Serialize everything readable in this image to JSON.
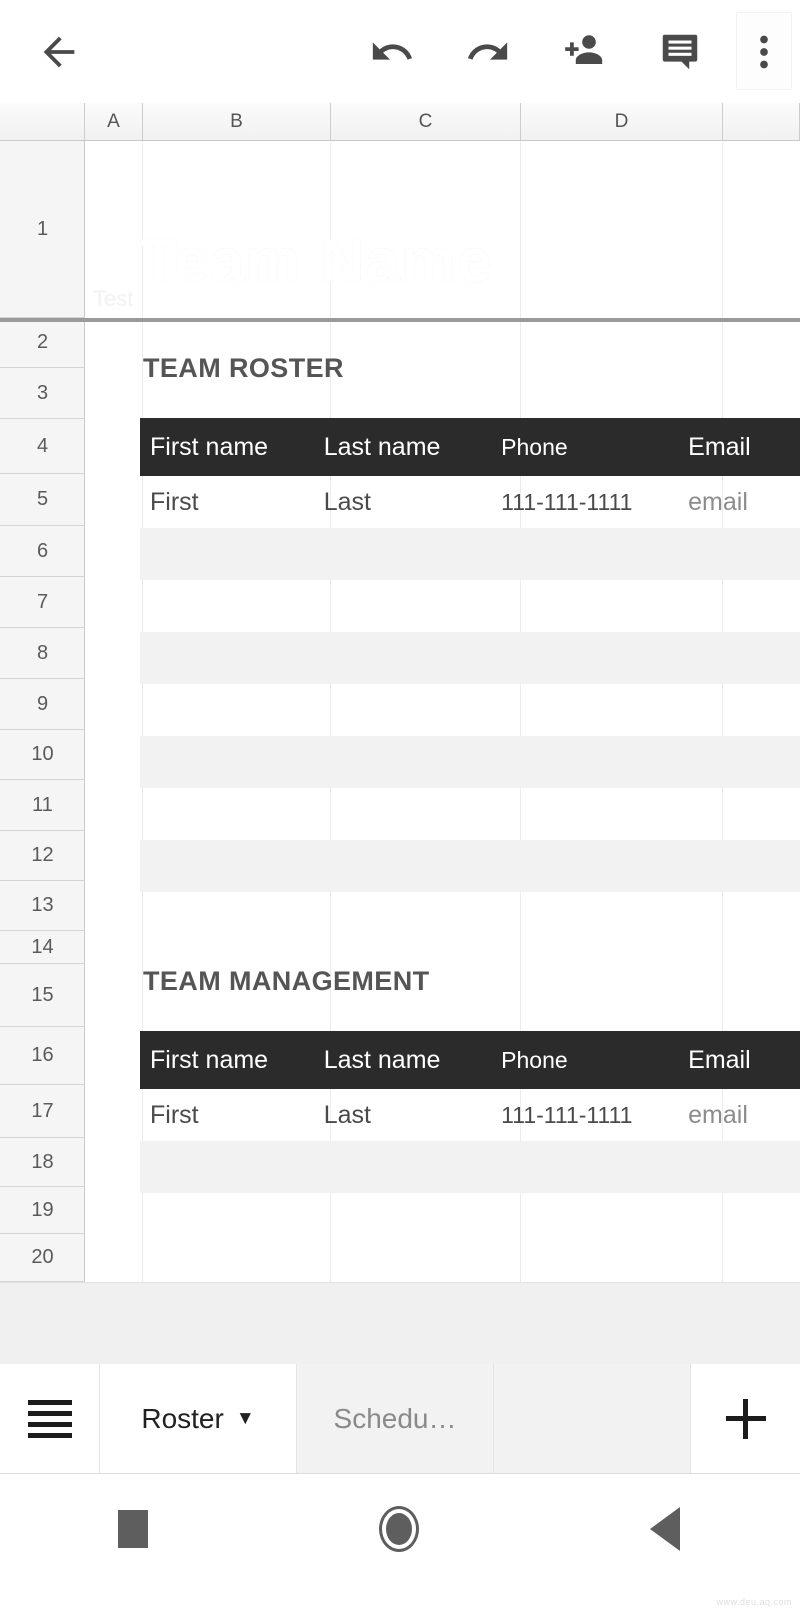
{
  "toolbar": {
    "back_label": "back-arrow",
    "undo_label": "Undo",
    "redo_label": "Redo",
    "share_label": "Share",
    "comment_label": "Comment",
    "more_label": "More options"
  },
  "spreadsheet": {
    "columns": [
      "A",
      "B",
      "C",
      "D"
    ],
    "row_numbers": [
      "1",
      "2",
      "3",
      "4",
      "5",
      "6",
      "7",
      "8",
      "9",
      "10",
      "11",
      "12",
      "13",
      "14",
      "15",
      "16",
      "17",
      "18",
      "19",
      "20"
    ],
    "document": {
      "title_watermark": "Team Name",
      "subtitle_watermark": "Test",
      "sections": [
        {
          "heading": "TEAM ROSTER",
          "headers": [
            "First name",
            "Last name",
            "Phone",
            "Email"
          ],
          "rows": [
            [
              "First",
              "Last",
              "111-111-1111",
              "email"
            ],
            [
              "",
              "",
              "",
              ""
            ],
            [
              "",
              "",
              "",
              ""
            ],
            [
              "",
              "",
              "",
              ""
            ],
            [
              "",
              "",
              "",
              ""
            ],
            [
              "",
              "",
              "",
              ""
            ],
            [
              "",
              "",
              "",
              ""
            ],
            [
              "",
              "",
              "",
              ""
            ]
          ]
        },
        {
          "heading": "TEAM MANAGEMENT",
          "headers": [
            "First name",
            "Last name",
            "Phone",
            "Email"
          ],
          "rows": [
            [
              "First",
              "Last",
              "111-111-1111",
              "email"
            ],
            [
              "",
              "",
              "",
              ""
            ]
          ]
        }
      ]
    }
  },
  "tabbar": {
    "menu_label": "All sheets",
    "tabs": [
      {
        "label": "Roster",
        "caret": "▼",
        "active": true
      },
      {
        "label": "Schedu…",
        "caret": "",
        "active": false
      },
      {
        "label": "",
        "caret": "",
        "active": false
      }
    ],
    "add_label": "Add sheet"
  },
  "navbar": {
    "recent_label": "Recents",
    "home_label": "Home",
    "back_label": "Back"
  },
  "watermark": "www.deu.aq.com",
  "colors": {
    "header_bar": "#2b2b2b",
    "alt_row": "#f2f2f2",
    "grid_line": "#d4d4d4",
    "text": "#4a4a4a",
    "muted": "#8c8c8c"
  }
}
